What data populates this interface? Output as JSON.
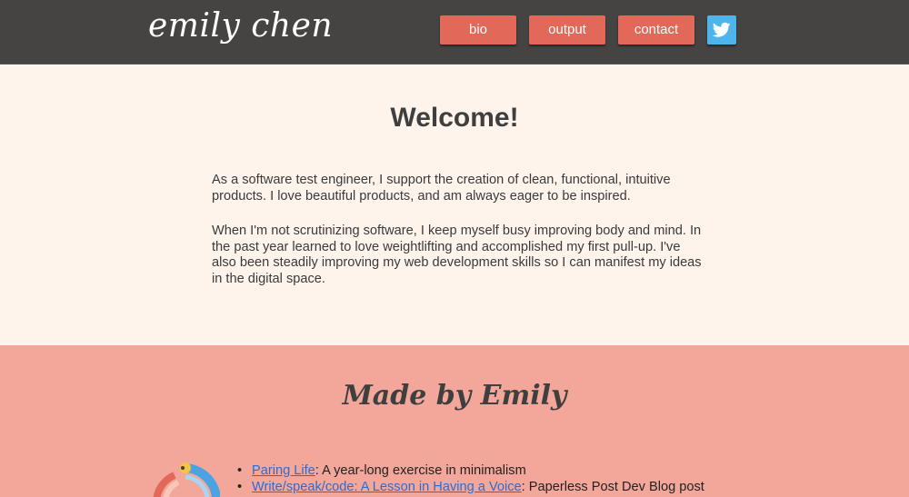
{
  "header": {
    "logo": "emily chen",
    "nav": [
      {
        "label": "bio"
      },
      {
        "label": "output"
      },
      {
        "label": "contact"
      }
    ],
    "social_icon": "twitter-bird-icon",
    "colors": {
      "bar": "#454442",
      "button": "#e2685a",
      "twitter": "#4fb3ec"
    }
  },
  "welcome": {
    "title": "Welcome!",
    "paragraphs": [
      "As a software test engineer, I support the creation of clean, functional, intuitive products. I love beautiful products, and am always eager to be inspired.",
      "When I'm not scrutinizing software, I keep myself busy improving body and mind. In the past year learned to love weightlifting and accomplished my first pull-up. I've also been steadily improving my web development skills so I can manifest my ideas in the digital space."
    ],
    "background": "#fef4ec"
  },
  "made_by": {
    "title": "Made by Emily",
    "background": "#f3a79a",
    "icon": "project-badge-icon",
    "items": [
      {
        "link": "Paring Life",
        "desc": ": A year-long exercise in minimalism"
      },
      {
        "link": "Write/speak/code: A Lesson in Having a Voice",
        "desc": ": Paperless Post Dev Blog post"
      }
    ]
  }
}
